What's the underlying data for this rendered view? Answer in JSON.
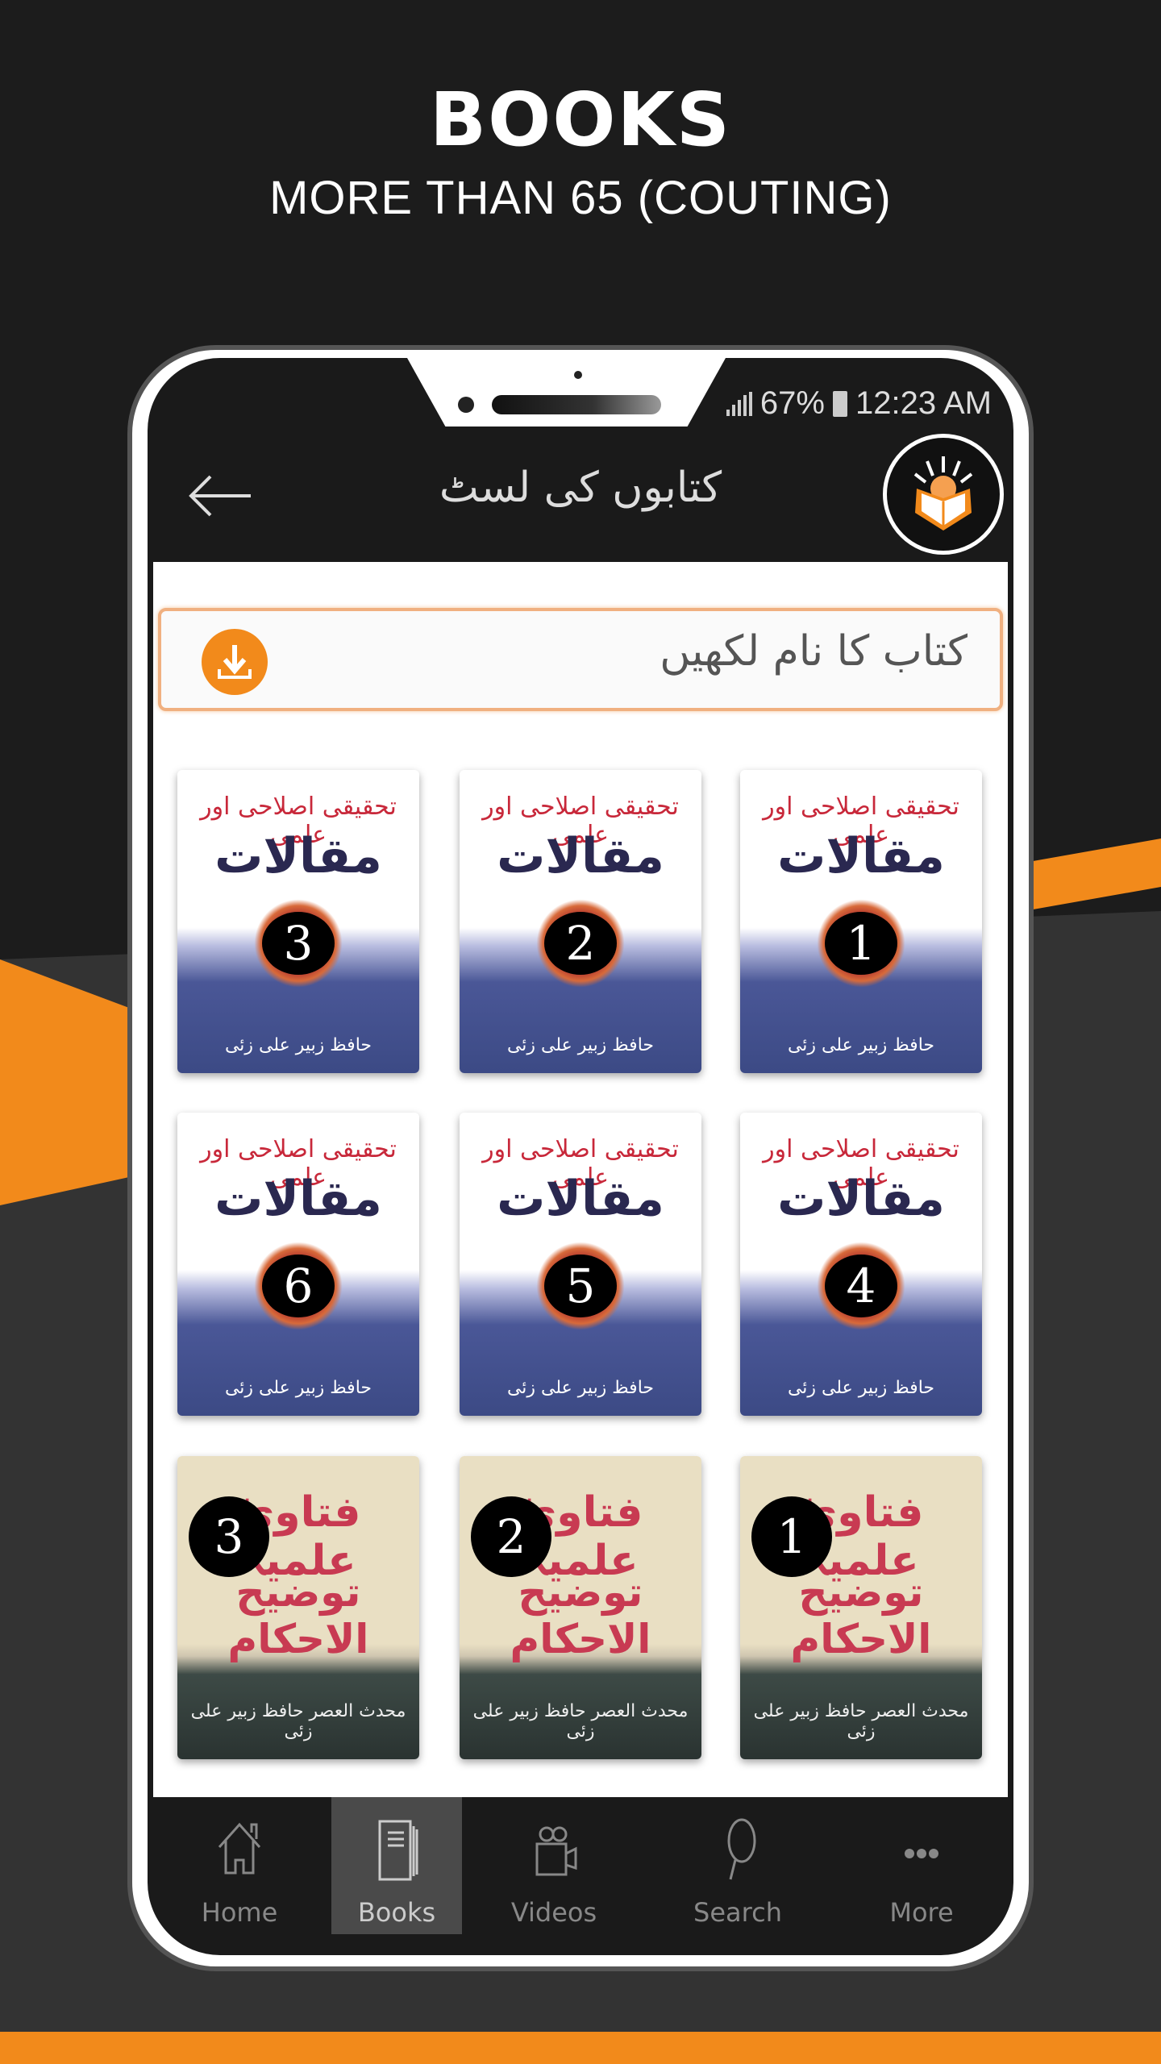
{
  "hero": {
    "title": "BOOKS",
    "subtitle": "MORE THAN 65 (COUTING)"
  },
  "status_bar": {
    "battery": "67%",
    "time": "12:23 AM"
  },
  "header": {
    "title": "کتابوں کی لسٹ",
    "back_icon": "arrow-left-icon",
    "logo_icon": "open-book-sun-logo"
  },
  "search": {
    "placeholder": "کتاب کا نام لکھیں",
    "button_icon": "download-icon"
  },
  "books": [
    {
      "style": "a",
      "subtitle": "تحقیقی اصلاحی اور علمی",
      "title": "مقالات",
      "number": "1",
      "author": "حافظ زبیر علی زئی"
    },
    {
      "style": "a",
      "subtitle": "تحقیقی اصلاحی اور علمی",
      "title": "مقالات",
      "number": "2",
      "author": "حافظ زبیر علی زئی"
    },
    {
      "style": "a",
      "subtitle": "تحقیقی اصلاحی اور علمی",
      "title": "مقالات",
      "number": "3",
      "author": "حافظ زبیر علی زئی"
    },
    {
      "style": "a",
      "subtitle": "تحقیقی اصلاحی اور علمی",
      "title": "مقالات",
      "number": "4",
      "author": "حافظ زبیر علی زئی"
    },
    {
      "style": "a",
      "subtitle": "تحقیقی اصلاحی اور علمی",
      "title": "مقالات",
      "number": "5",
      "author": "حافظ زبیر علی زئی"
    },
    {
      "style": "a",
      "subtitle": "تحقیقی اصلاحی اور علمی",
      "title": "مقالات",
      "number": "6",
      "author": "حافظ زبیر علی زئی"
    },
    {
      "style": "b",
      "title": "فتاویٰ علمیہ",
      "subtitle": "توضیح الاحکام",
      "number": "1",
      "author": "محدث العصر حافظ زبیر علی زئی"
    },
    {
      "style": "b",
      "title": "فتاویٰ علمیہ",
      "subtitle": "توضیح الاحکام",
      "number": "2",
      "author": "محدث العصر حافظ زبیر علی زئی"
    },
    {
      "style": "b",
      "title": "فتاویٰ علمیہ",
      "subtitle": "توضیح الاحکام",
      "number": "3",
      "author": "محدث العصر حافظ زبیر علی زئی"
    }
  ],
  "nav": [
    {
      "label": "Home",
      "icon": "home-icon"
    },
    {
      "label": "Books",
      "icon": "book-icon",
      "active": true
    },
    {
      "label": "Videos",
      "icon": "video-camera-icon"
    },
    {
      "label": "Search",
      "icon": "search-icon"
    },
    {
      "label": "More",
      "icon": "more-dots-icon"
    }
  ],
  "colors": {
    "accent": "#f28a1b",
    "background": "#1c1c1c",
    "active_tab": "#4a4a4a"
  }
}
